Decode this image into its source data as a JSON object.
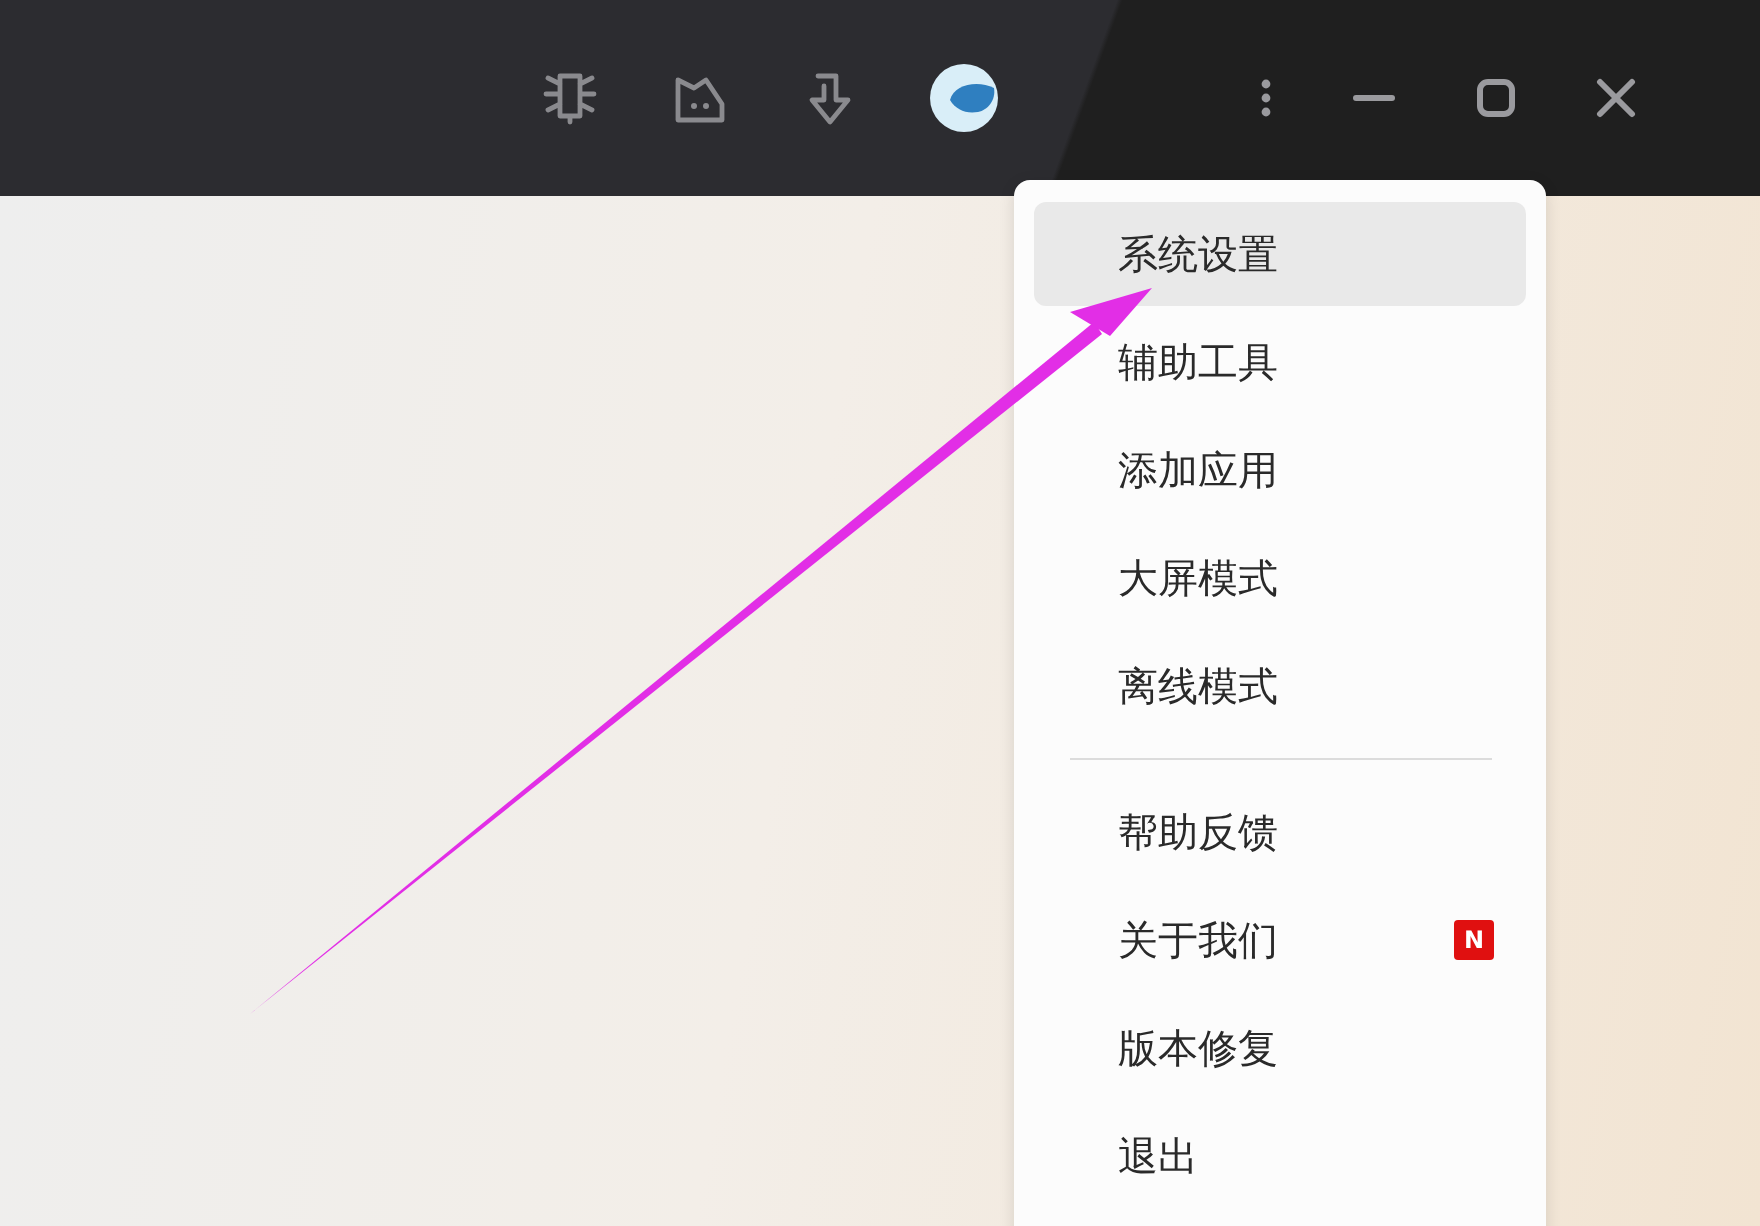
{
  "toolbar": {
    "icons": [
      {
        "kind": "bot"
      },
      {
        "kind": "chat"
      },
      {
        "kind": "download"
      },
      {
        "kind": "avatar"
      }
    ]
  },
  "window_controls": [
    {
      "kind": "more"
    },
    {
      "kind": "minimize"
    },
    {
      "kind": "maximize"
    },
    {
      "kind": "close"
    }
  ],
  "menu": {
    "groups": [
      [
        {
          "label": "系统设置",
          "selected": true
        },
        {
          "label": "辅助工具",
          "selected": false
        },
        {
          "label": "添加应用",
          "selected": false
        },
        {
          "label": "大屏模式",
          "selected": false
        },
        {
          "label": "离线模式",
          "selected": false
        }
      ],
      [
        {
          "label": "帮助反馈",
          "selected": false
        },
        {
          "label": "关于我们",
          "selected": false,
          "badge": "N"
        },
        {
          "label": "版本修复",
          "selected": false
        },
        {
          "label": "退出",
          "selected": false
        }
      ]
    ]
  },
  "annotation": {
    "kind": "arrow"
  }
}
